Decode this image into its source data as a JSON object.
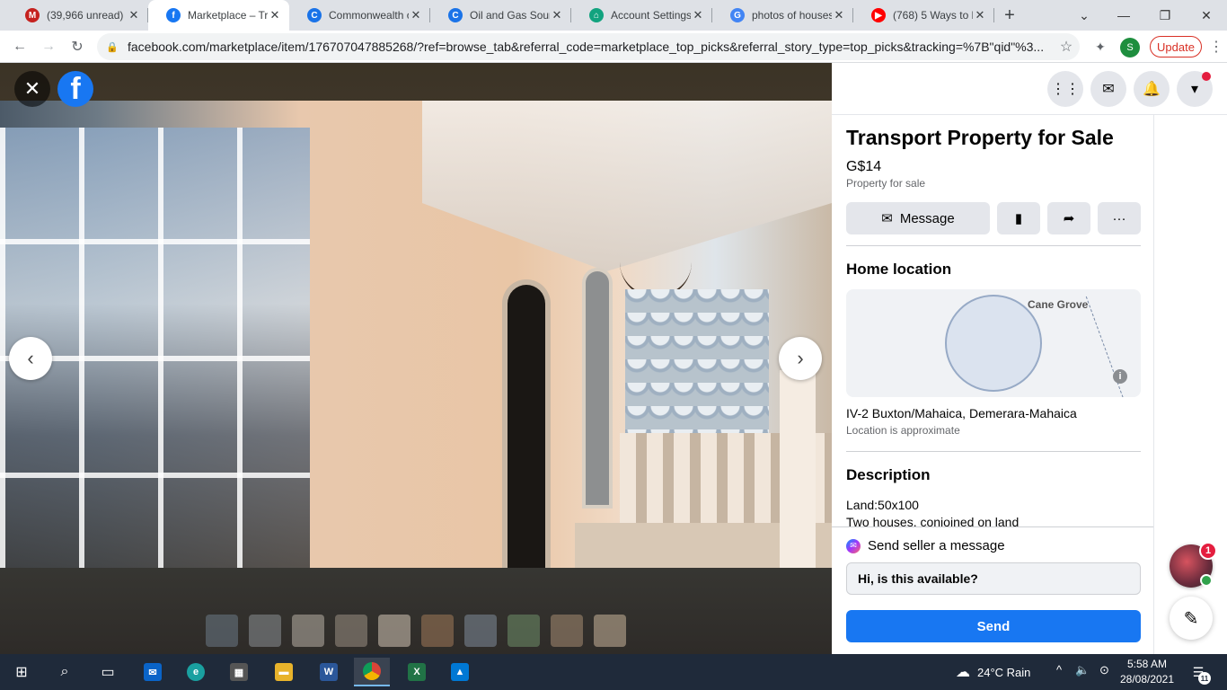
{
  "browser": {
    "tabs": [
      {
        "title": "(39,966 unread) -",
        "icon": "gmail-icon",
        "color": "#c5221f",
        "glyph": "M",
        "active": false
      },
      {
        "title": "Marketplace – Tra",
        "icon": "facebook-icon",
        "color": "#1877f2",
        "glyph": "f",
        "active": true
      },
      {
        "title": "Commonwealth o",
        "icon": "globe-c-icon",
        "color": "#1a73e8",
        "glyph": "C",
        "active": false
      },
      {
        "title": "Oil and Gas Sourc",
        "icon": "globe-c-icon",
        "color": "#1a73e8",
        "glyph": "C",
        "active": false
      },
      {
        "title": "Account Settings",
        "icon": "house-icon",
        "color": "#12a37f",
        "glyph": "⌂",
        "active": false
      },
      {
        "title": "photos of houses",
        "icon": "google-icon",
        "color": "#4285f4",
        "glyph": "G",
        "active": false
      },
      {
        "title": "(768) 5 Ways to l",
        "icon": "youtube-icon",
        "color": "#ff0000",
        "glyph": "▶",
        "active": false
      }
    ],
    "new_tab": "+",
    "url": "facebook.com/marketplace/item/176707047885268/?ref=browse_tab&referral_code=marketplace_top_picks&referral_story_type=top_picks&tracking=%7B\"qid\"%3...",
    "profile_initial": "S",
    "update_label": "Update"
  },
  "viewer": {
    "thumbnails_count": 10
  },
  "listing": {
    "title": "Transport Property for Sale",
    "price": "G$14",
    "category": "Property for sale",
    "message_button": "Message",
    "home_location_heading": "Home location",
    "map_place": "Cane Grove",
    "address": "IV-2 Buxton/Mahaica, Demerara-Mahaica",
    "location_note": "Location is approximate",
    "description_heading": "Description",
    "description_lines": [
      "Land:50x100",
      "Two houses, conjoined on land"
    ]
  },
  "message": {
    "heading": "Send seller a message",
    "input_value": "Hi, is this available?",
    "send_label": "Send"
  },
  "chat": {
    "badge": "1"
  },
  "taskbar": {
    "weather": "24°C  Rain",
    "time": "5:58 AM",
    "date": "28/08/2021",
    "notifications": "11"
  }
}
